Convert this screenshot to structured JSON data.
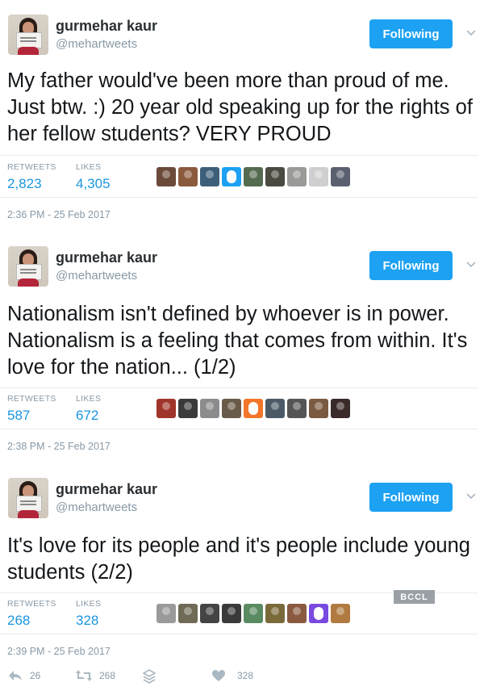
{
  "tweets": [
    {
      "name": "gurmehar kaur",
      "handle": "@mehartweets",
      "follow_label": "Following",
      "text": "My father would've been more than proud of me. Just btw. :) 20 year old speaking up for the rights of her fellow students? VERY PROUD",
      "retweets_label": "RETWEETS",
      "retweets": "2,823",
      "likes_label": "LIKES",
      "likes": "4,305",
      "timestamp": "2:36 PM - 25 Feb 2017",
      "likers": [
        "#6b4a3a",
        "#8a5a3c",
        "#3e5f7a",
        "egg",
        "#556b50",
        "#4a4a40",
        "#9a9a96",
        "#cfcfcf",
        "#5a6070"
      ]
    },
    {
      "name": "gurmehar kaur",
      "handle": "@mehartweets",
      "follow_label": "Following",
      "text": "Nationalism isn't defined by whoever is in power. Nationalism is a feeling that comes from within. It's love for the nation... (1/2)",
      "retweets_label": "RETWEETS",
      "retweets": "587",
      "likes_label": "LIKES",
      "likes": "672",
      "timestamp": "2:38 PM - 25 Feb 2017",
      "likers": [
        "#a0342a",
        "#3a3a3a",
        "#8c8c8c",
        "#6a5a48",
        "egg-orange",
        "#4b5a66",
        "#555555",
        "#7a5a40",
        "#3b2a2a"
      ]
    },
    {
      "name": "gurmehar kaur",
      "handle": "@mehartweets",
      "follow_label": "Following",
      "text": "It's love for its people and it's people include young students (2/2)",
      "retweets_label": "RETWEETS",
      "retweets": "268",
      "likes_label": "LIKES",
      "likes": "328",
      "timestamp": "2:39 PM - 25 Feb 2017",
      "likers": [
        "#9a9a9a",
        "#6f6a55",
        "#444444",
        "#3a3a3a",
        "#5a8a60",
        "#7a6a3a",
        "#8a5a40",
        "egg-purple",
        "#b07a40"
      ]
    }
  ],
  "watermark": "BCCL",
  "actions": {
    "reply_count": "26",
    "retweet_count": "268",
    "like_count": "328"
  },
  "colors": {
    "accent": "#1da1f2",
    "link": "#1b95e0",
    "muted": "#8899a6"
  }
}
